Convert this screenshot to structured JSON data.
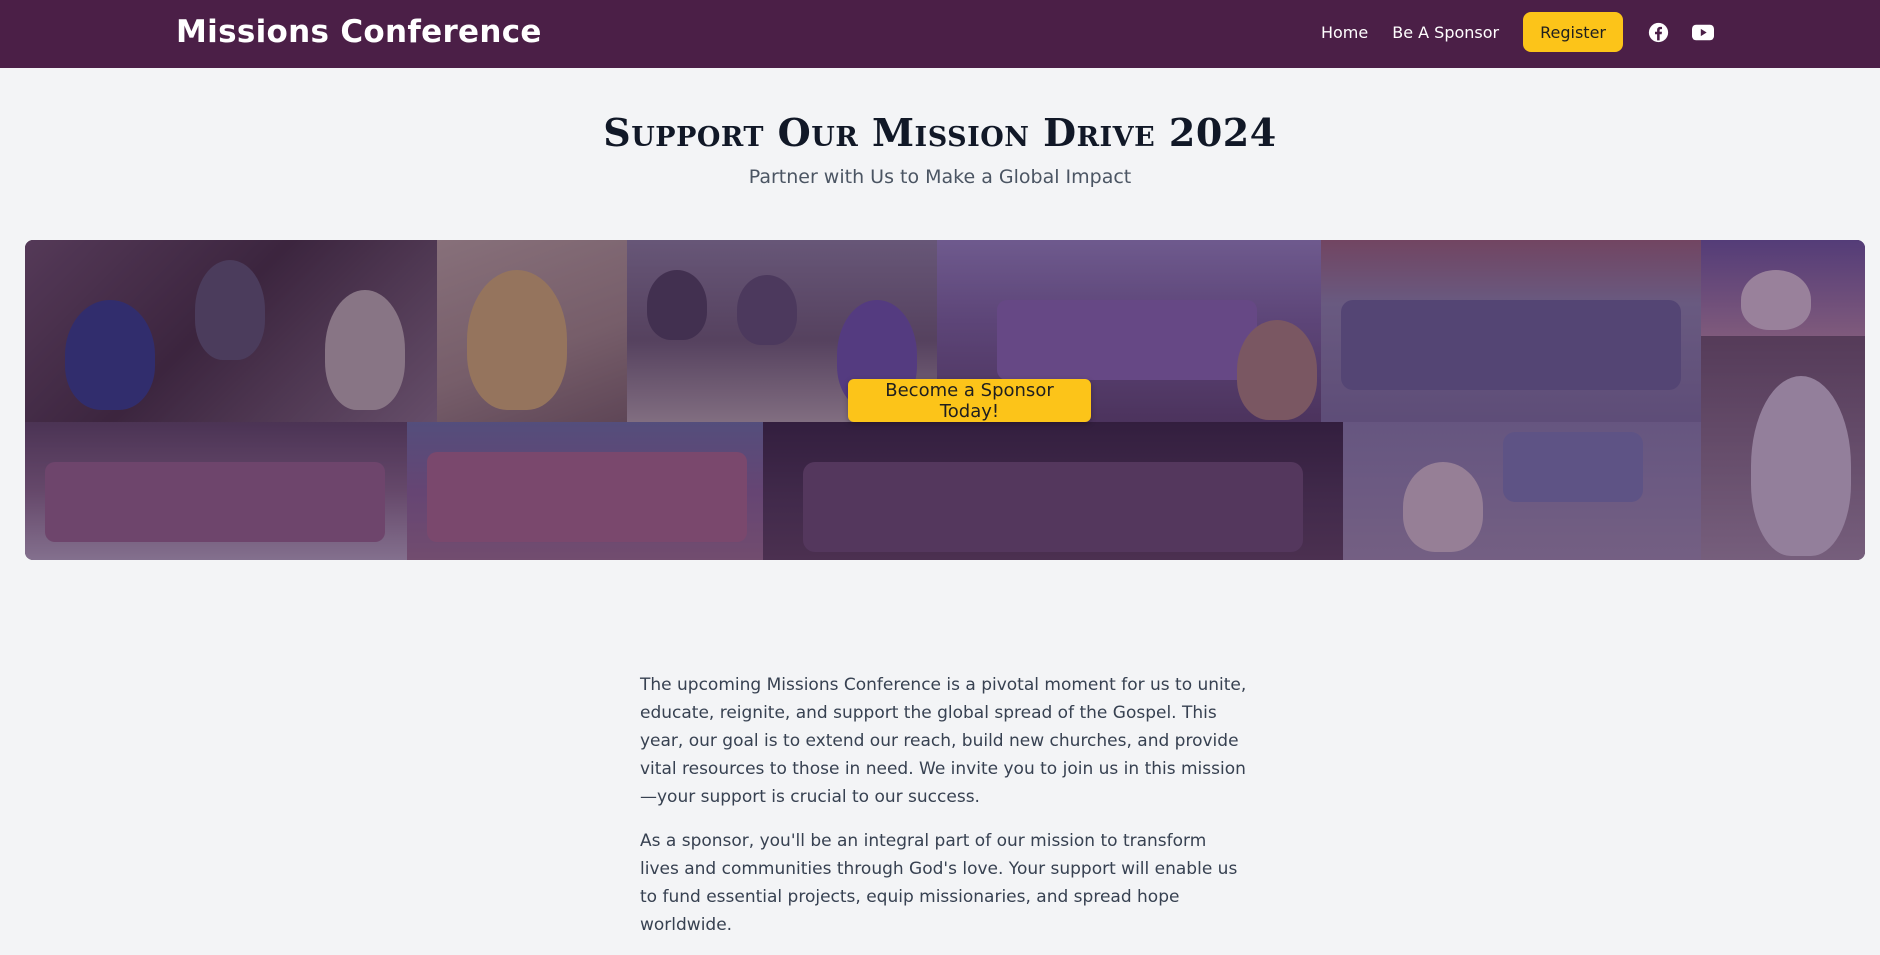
{
  "nav": {
    "brand": "Missions Conference",
    "links": [
      {
        "label": "Home"
      },
      {
        "label": "Be A Sponsor"
      }
    ],
    "register_label": "Register",
    "social": [
      {
        "icon": "facebook-icon"
      },
      {
        "icon": "youtube-icon"
      }
    ]
  },
  "header": {
    "title": "Support Our Mission Drive 2024",
    "subtitle": "Partner with Us to Make a Global Impact"
  },
  "hero": {
    "cta_label": "Become a Sponsor Today!",
    "overlay_color": "#3a1848"
  },
  "content": {
    "paragraphs": [
      "The upcoming Missions Conference is a pivotal moment for us to unite, educate, reignite, and support the global spread of the Gospel. This year, our goal is to extend our reach, build new churches, and provide vital resources to those in need. We invite you to join us in this mission—your support is crucial to our success.",
      "As a sponsor, you'll be an integral part of our mission to transform lives and communities through God's love. Your support will enable us to fund essential projects, equip missionaries, and spread hope worldwide."
    ]
  },
  "colors": {
    "nav_background": "#4b1f47",
    "accent": "#fcc419",
    "page_background": "#f3f4f6",
    "title": "#111827",
    "body_text": "#374151"
  }
}
